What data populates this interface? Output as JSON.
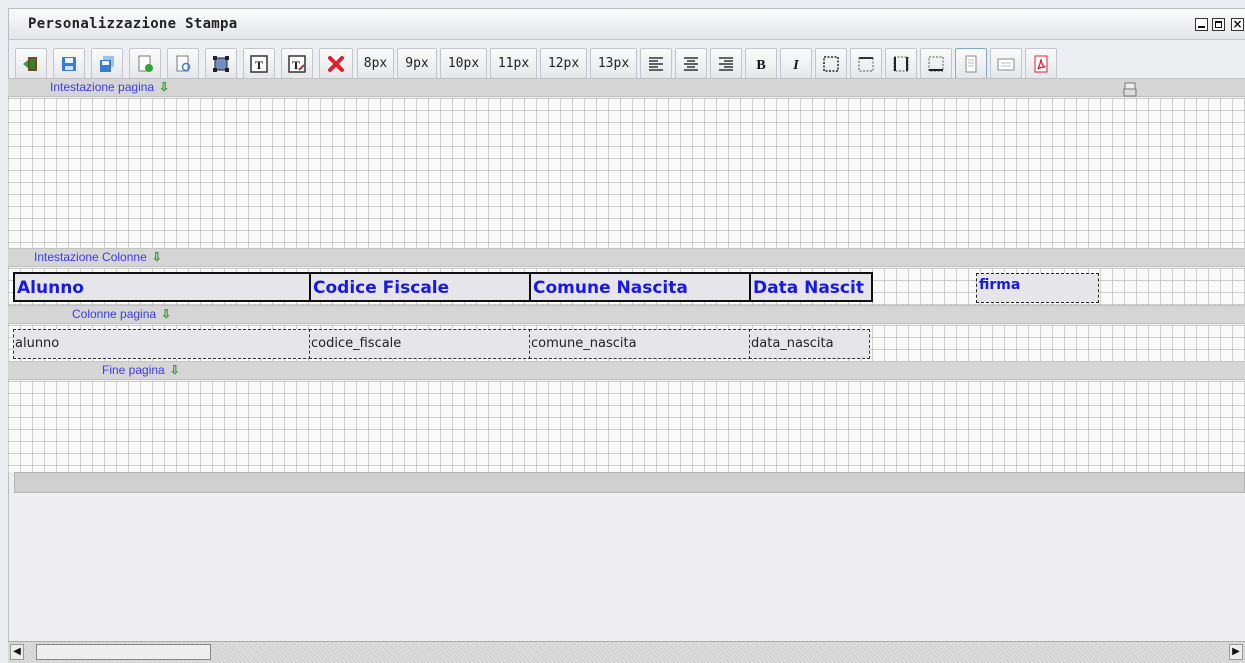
{
  "window": {
    "title": "Personalizzazione Stampa"
  },
  "toolbar": {
    "font_sizes": [
      "8px",
      "9px",
      "10px",
      "11px",
      "12px",
      "13px"
    ],
    "icons": [
      "exit-icon",
      "save-icon",
      "save-as-icon",
      "new-page-icon",
      "preview-icon",
      "select-area-icon",
      "text-field-icon",
      "text-edit-icon",
      "delete-icon",
      "align-left-icon",
      "align-center-icon",
      "align-right-icon",
      "bold-icon",
      "italic-icon",
      "border-all-icon",
      "border-top-icon",
      "border-sides-icon",
      "border-bottom-icon",
      "portrait-icon",
      "landscape-icon",
      "pdf-icon"
    ]
  },
  "bands": {
    "page_header": "Intestazione pagina",
    "column_header": "Intestazione Colonne",
    "page_columns": "Colonne pagina",
    "page_footer": "Fine pagina"
  },
  "column_headers": [
    "Alunno",
    "Codice Fiscale",
    "Comune Nascita",
    "Data Nascit",
    "firma"
  ],
  "column_fields": [
    "alunno",
    "codice_fiscale",
    "comune_nascita",
    "data_nascita"
  ],
  "colors": {
    "band_label": "#3b3bf0",
    "arrow": "#2f9e2a",
    "header_text": "#1818e8",
    "delete": "#e0202a",
    "pdf": "#d8262b"
  }
}
